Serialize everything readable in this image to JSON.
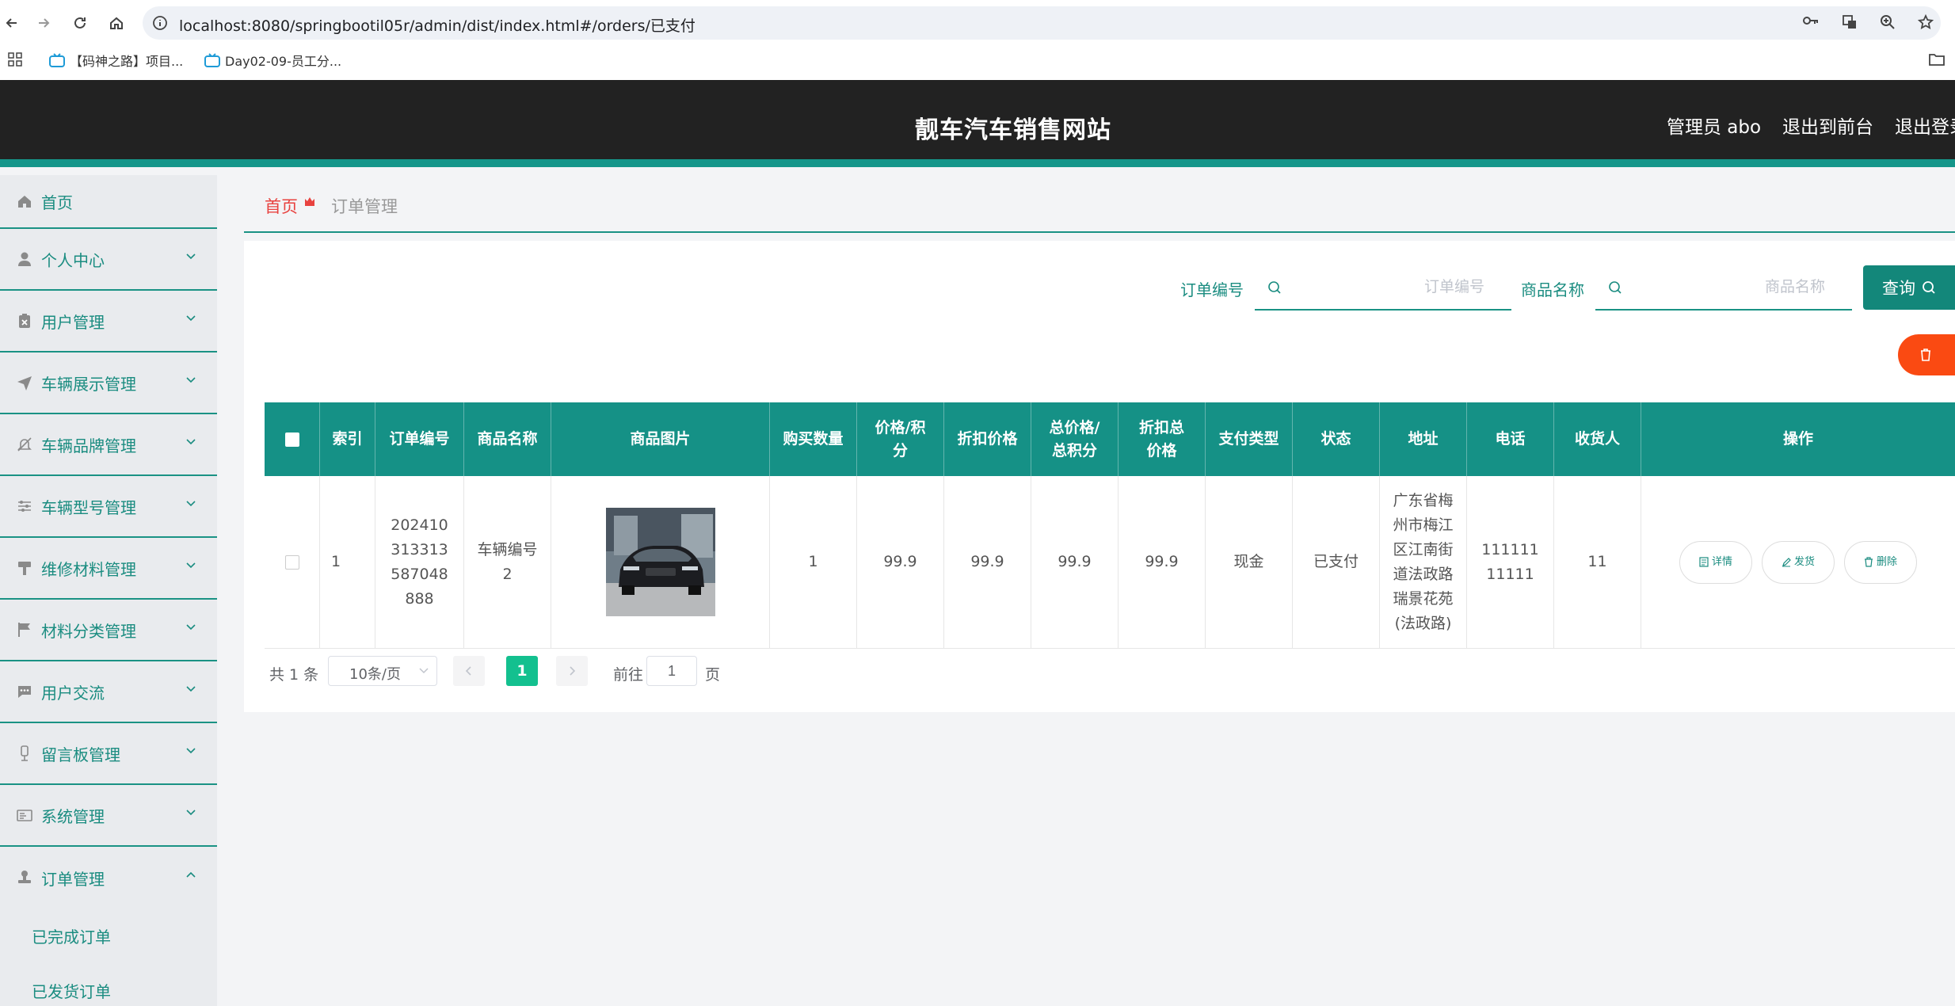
{
  "browser": {
    "url": "localhost:8080/springbootil05r/admin/dist/index.html#/orders/已支付",
    "bookmarks": [
      "【码神之路】项目...",
      "Day02-09-员工分..."
    ]
  },
  "header": {
    "title": "靓车汽车销售网站",
    "admin_label": "管理员 abo",
    "to_front": "退出到前台",
    "logout": "退出登录"
  },
  "sidebar": {
    "items": [
      {
        "label": "首页",
        "icon": "home-icon"
      },
      {
        "label": "个人中心",
        "icon": "user-icon"
      },
      {
        "label": "用户管理",
        "icon": "clipboard-x-icon"
      },
      {
        "label": "车辆展示管理",
        "icon": "send-icon"
      },
      {
        "label": "车辆品牌管理",
        "icon": "bell-off-icon"
      },
      {
        "label": "车辆型号管理",
        "icon": "sliders-icon"
      },
      {
        "label": "维修材料管理",
        "icon": "paint-roller-icon"
      },
      {
        "label": "材料分类管理",
        "icon": "flag-icon"
      },
      {
        "label": "用户交流",
        "icon": "chat-icon"
      },
      {
        "label": "留言板管理",
        "icon": "microphone-icon"
      },
      {
        "label": "系统管理",
        "icon": "id-card-icon"
      },
      {
        "label": "订单管理",
        "icon": "stamp-icon"
      }
    ],
    "sub_items": [
      "已完成订单",
      "已发货订单"
    ]
  },
  "breadcrumb": {
    "home": "首页",
    "current": "订单管理"
  },
  "search": {
    "order_no_label": "订单编号",
    "order_no_placeholder": "订单编号",
    "product_label": "商品名称",
    "product_placeholder": "商品名称",
    "query_label": "查询"
  },
  "table": {
    "headers": [
      "索引",
      "订单编号",
      "商品名称",
      "商品图片",
      "购买数量",
      "价格/积分",
      "折扣价格",
      "总价格/总积分",
      "折扣总价格",
      "支付类型",
      "状态",
      "地址",
      "电话",
      "收货人",
      "操作"
    ],
    "rows": [
      {
        "index": "1",
        "order_no": "202410313313587048888",
        "product": "车辆编号2",
        "quantity": "1",
        "price": "99.9",
        "discount_price": "99.9",
        "total": "99.9",
        "discount_total": "99.9",
        "pay_type": "现金",
        "status": "已支付",
        "address": "广东省梅州市梅江区江南街道法政路瑞景花苑(法政路)",
        "phone": "11111111111",
        "receiver": "11"
      }
    ],
    "actions": {
      "detail": "详情",
      "ship": "发货",
      "delete": "删除"
    }
  },
  "pagination": {
    "total": "共 1 条",
    "page_size": "10条/页",
    "current_page": "1",
    "goto_label": "前往",
    "goto_value": "1",
    "unit": "页"
  },
  "colors": {
    "accent": "#159186",
    "danger": "#fa4a12",
    "header_bg": "#222222",
    "breadcrumb_home": "#e8423f"
  }
}
